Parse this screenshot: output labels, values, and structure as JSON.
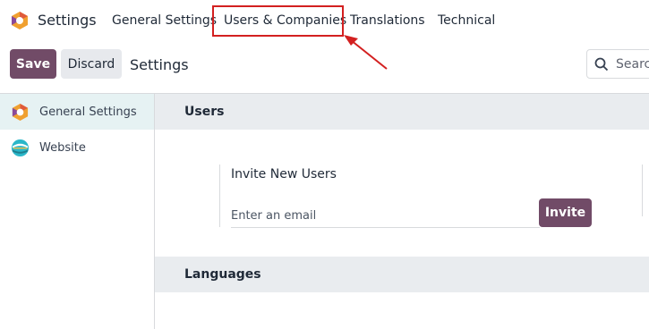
{
  "topbar": {
    "app_title": "Settings",
    "menu": {
      "general": "General Settings",
      "users": "Users & Companies",
      "translations": "Translations",
      "technical": "Technical"
    }
  },
  "control_panel": {
    "save_label": "Save",
    "discard_label": "Discard",
    "title": "Settings",
    "search_placeholder": "Search..."
  },
  "sidebar": {
    "items": [
      {
        "label": "General Settings",
        "icon": "odoo-logo-icon",
        "active": true
      },
      {
        "label": "Website",
        "icon": "website-icon",
        "active": false
      }
    ]
  },
  "sections": {
    "users": {
      "title": "Users",
      "invite_title": "Invite New Users",
      "email_placeholder": "Enter an email",
      "invite_label": "Invite"
    },
    "languages": {
      "title": "Languages"
    }
  },
  "colors": {
    "brand": "#714b67",
    "highlight": "#d32020",
    "active_sidebar": "#e6f2f3",
    "section_bg": "#e9ecef"
  }
}
